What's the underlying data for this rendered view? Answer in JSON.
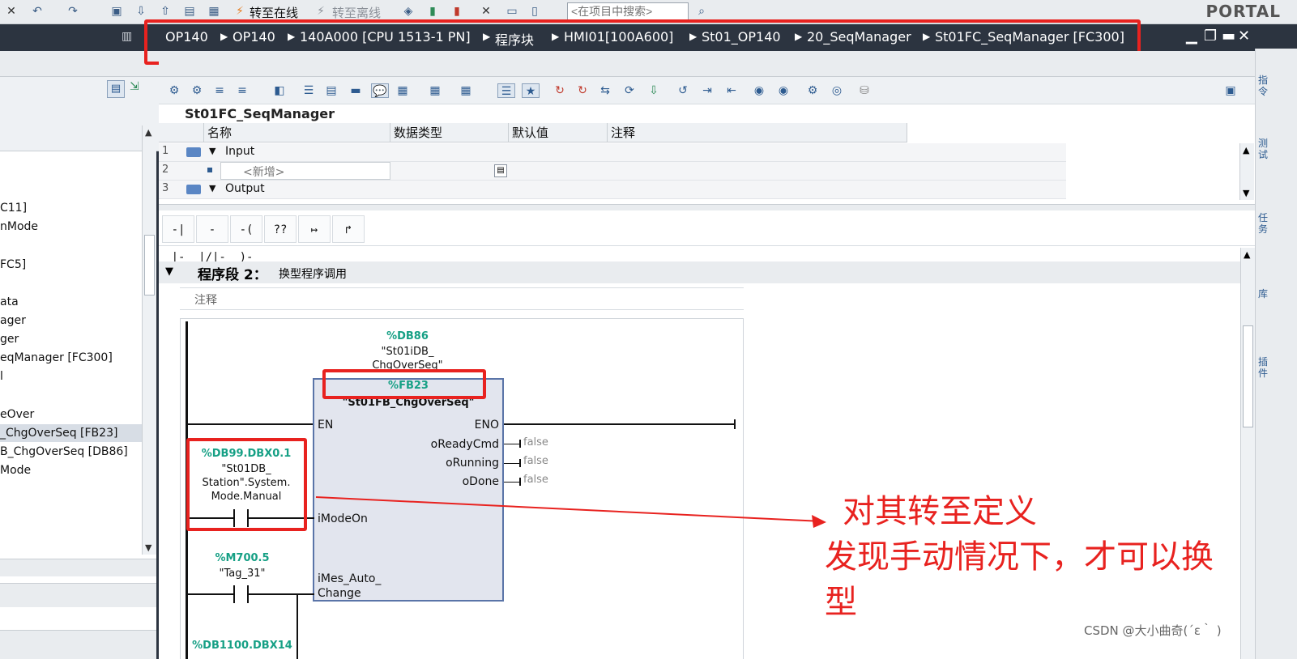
{
  "toolbar": {
    "go_online": "转至在线",
    "go_offline": "转至离线",
    "search_placeholder": "<在项目中搜索>",
    "portal": "PORTAL"
  },
  "breadcrumb": [
    "OP140",
    "OP140",
    "140A000 [CPU 1513-1 PN]",
    "程序块",
    "HMI01[100A600]",
    "St01_OP140",
    "20_SeqManager",
    "St01FC_SeqManager [FC300]"
  ],
  "tree": {
    "items": [
      "C11]",
      "nMode",
      "FC5]",
      "ata",
      "ager",
      "ger",
      "eqManager [FC300]",
      "l",
      "eOver",
      "_ChgOverSeq [FB23]",
      "B_ChgOverSeq [DB86]",
      "Mode"
    ]
  },
  "block_title": "St01FC_SeqManager",
  "interface": {
    "headers": [
      "名称",
      "数据类型",
      "默认值",
      "注释"
    ],
    "rows": [
      {
        "num": "1",
        "name": "Input"
      },
      {
        "num": "2",
        "name": "<新增>"
      },
      {
        "num": "3",
        "name": "Output"
      }
    ]
  },
  "instructions": [
    "-| |-",
    "-|/|-",
    "-( )-",
    "??",
    "↦",
    "↱"
  ],
  "network": {
    "title": "程序段 2：",
    "subtitle": "换型程序调用",
    "comment": "注释",
    "instance_db_addr": "%DB86",
    "instance_db_name_1": "\"St01iDB_",
    "instance_db_name_2": "ChgOverSeq\"",
    "fb_addr": "%FB23",
    "fb_name": "\"St01FB_ChgOverSeq\"",
    "en": "EN",
    "eno": "ENO",
    "outputs": [
      {
        "name": "oReadyCmd",
        "value": "false"
      },
      {
        "name": "oRunning",
        "value": "false"
      },
      {
        "name": "oDone",
        "value": "false"
      }
    ],
    "input1_pin": "iModeOn",
    "input2_pin_1": "iMes_Auto_",
    "input2_pin_2": "Change",
    "contact1_addr": "%DB99.DBX0.1",
    "contact1_name_1": "\"St01DB_",
    "contact1_name_2": "Station\".System.",
    "contact1_name_3": "Mode.Manual",
    "contact2_addr": "%M700.5",
    "contact2_name": "\"Tag_31\"",
    "contact3_addr": "%DB1100.DBX14"
  },
  "annotation": {
    "line1": "对其转至定义",
    "line2": "发现手动情况下，才可以换",
    "line3": "型"
  },
  "right_tabs": [
    "指令",
    "测试",
    "任务",
    "库",
    "插件"
  ],
  "watermark": "CSDN @大小曲奇(´ε｀ )"
}
